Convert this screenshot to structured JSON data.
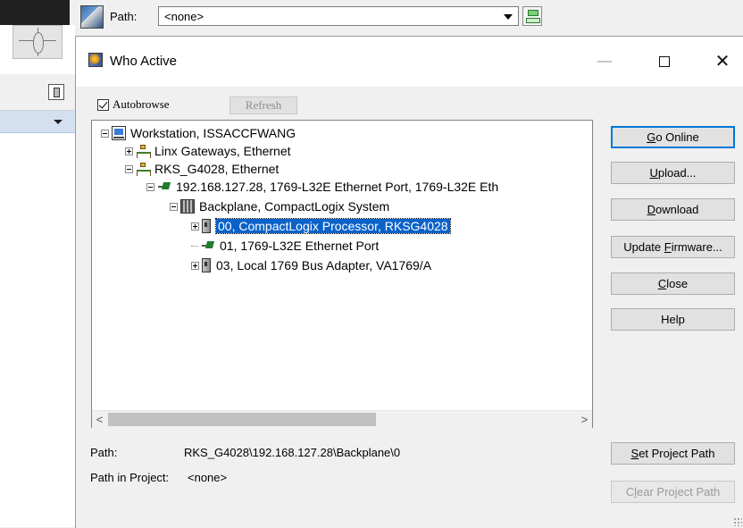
{
  "background_app": {
    "path_label": "Path:",
    "path_value": "<none>"
  },
  "dialog": {
    "title": "Who Active",
    "window_controls": {
      "minimize": "—",
      "maximize": "",
      "close": "✕"
    },
    "autobrowse": {
      "label": "Autobrowse",
      "checked": true
    },
    "refresh_label": "Refresh",
    "tree": [
      {
        "label": "Workstation, ISSACCFWANG",
        "icon": "workstation-icon",
        "expander": "minus"
      },
      {
        "label": "Linx Gateways, Ethernet",
        "icon": "network-icon",
        "expander": "plus"
      },
      {
        "label": "RKS_G4028, Ethernet",
        "icon": "network-icon",
        "expander": "minus"
      },
      {
        "label": "192.168.127.28, 1769-L32E Ethernet Port, 1769-L32E Eth",
        "icon": "ethernet-port-icon",
        "expander": "minus"
      },
      {
        "label": "Backplane, CompactLogix System",
        "icon": "backplane-icon",
        "expander": "minus"
      },
      {
        "label": "00, CompactLogix Processor, RKSG4028",
        "icon": "module-icon",
        "expander": "plus",
        "selected": true
      },
      {
        "label": "01, 1769-L32E Ethernet Port",
        "icon": "ethernet-port-icon",
        "expander": "none"
      },
      {
        "label": "03, Local 1769 Bus Adapter, VA1769/A",
        "icon": "module-icon",
        "expander": "plus"
      }
    ],
    "scroll": {
      "left": "<",
      "right": ">"
    },
    "buttons": {
      "go_online": {
        "pre": "",
        "key": "G",
        "post": "o Online"
      },
      "upload": {
        "pre": "",
        "key": "U",
        "post": "pload..."
      },
      "download": {
        "pre": "",
        "key": "D",
        "post": "ownload"
      },
      "update_firmware": {
        "pre": "Update ",
        "key": "F",
        "post": "irmware..."
      },
      "close": {
        "pre": "",
        "key": "C",
        "post": "lose"
      },
      "help": {
        "pre": "Help",
        "key": "",
        "post": ""
      },
      "set_project_path": {
        "pre": "",
        "key": "S",
        "post": "et Project Path"
      },
      "clear_project_path": {
        "pre": "C",
        "key": "l",
        "post": "ear Project Path"
      }
    },
    "path_label": "Path:",
    "path_value": "RKS_G4028\\192.168.127.28\\Backplane\\0",
    "path_in_project_label": "Path in Project:",
    "path_in_project_value": "<none>"
  }
}
